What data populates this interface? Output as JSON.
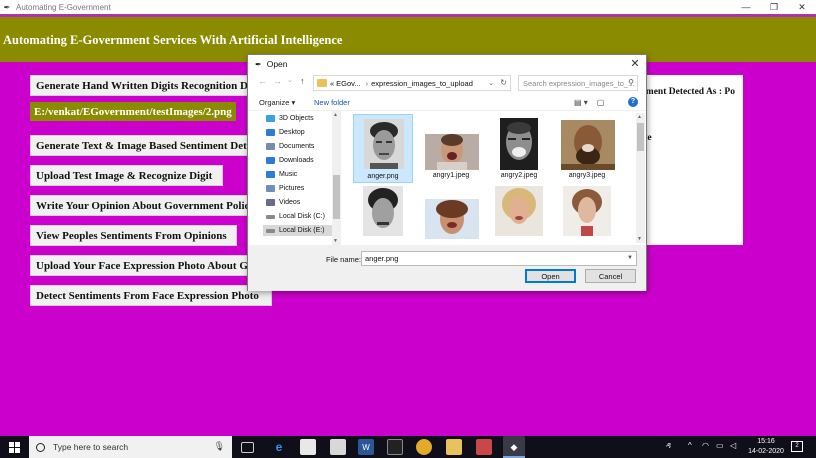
{
  "window": {
    "title": "Automating E-Government",
    "minimize": "—",
    "maximize": "❐",
    "close": "✕"
  },
  "banner": {
    "title": "Automating E-Government Services With Artificial Intelligence"
  },
  "buttons": [
    {
      "label": "Generate Hand Written Digits Recognition Deep Learning Model"
    },
    {
      "label": "Generate Text & Image Based Sentiment Detection Deep Learning Model"
    },
    {
      "label": "Upload Test Image & Recognize Digit"
    },
    {
      "label": "Write Your Opinion About Government Policies"
    },
    {
      "label": "View Peoples Sentiments From Opinions"
    },
    {
      "label": "Upload Your Face Expression Photo About Government Policies"
    },
    {
      "label": "Detect Sentiments From Face Expression Photo"
    }
  ],
  "path_label": "E:/venkat/EGovernment/testImages/2.png",
  "result": {
    "line1": "timent Detected As : Po",
    "line2": "ive"
  },
  "dialog": {
    "title": "Open",
    "close": "✕",
    "nav_back": "←",
    "nav_forward": "→",
    "nav_recent": "⌄",
    "nav_up": "↑",
    "address": {
      "prefix": "«",
      "crumb1": "EGov...",
      "separator": "›",
      "crumb2": "expression_images_to_upload"
    },
    "search_placeholder": "Search expression_images_to_...",
    "organize": "Organize ▾",
    "new_folder": "New folder",
    "nav_items": [
      {
        "label": "3D Objects",
        "icon": "3d-objects-icon",
        "color": "#3aa0e0"
      },
      {
        "label": "Desktop",
        "icon": "desktop-icon",
        "color": "#2f7bd8"
      },
      {
        "label": "Documents",
        "icon": "documents-icon",
        "color": "#7a8da8"
      },
      {
        "label": "Downloads",
        "icon": "downloads-icon",
        "color": "#2f7bd8"
      },
      {
        "label": "Music",
        "icon": "music-icon",
        "color": "#2f7bd8"
      },
      {
        "label": "Pictures",
        "icon": "pictures-icon",
        "color": "#6d8fb8"
      },
      {
        "label": "Videos",
        "icon": "videos-icon",
        "color": "#6a6a8a"
      },
      {
        "label": "Local Disk (C:)",
        "icon": "local-disk-icon",
        "color": "#8a8a8a"
      },
      {
        "label": "Local Disk (E:)",
        "icon": "local-disk-icon",
        "color": "#8a8a8a",
        "selected": true
      }
    ],
    "files": [
      {
        "name": "anger.png",
        "selected": true
      },
      {
        "name": "angry1.jpeg"
      },
      {
        "name": "angry2.jpeg"
      },
      {
        "name": "angry3.jpeg"
      },
      {
        "name": ""
      },
      {
        "name": ""
      },
      {
        "name": ""
      },
      {
        "name": ""
      }
    ],
    "file_name_label": "File name:",
    "file_name_value": "anger.png",
    "open_button": "Open",
    "cancel_button": "Cancel"
  },
  "taskbar": {
    "search_placeholder": "Type here to search",
    "time": "15:16",
    "date": "14-02-2020"
  },
  "colors": {
    "background": "#cc00cc",
    "banner": "#8b8b00",
    "accent": "#0078d7"
  }
}
